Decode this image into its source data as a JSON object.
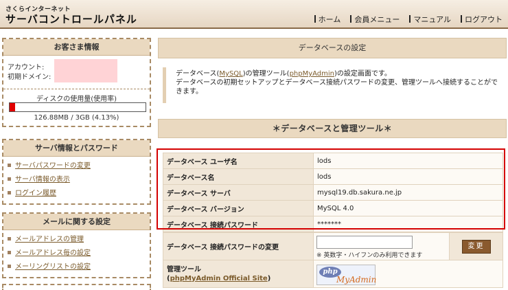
{
  "header": {
    "logo_sub": "さくらインターネット",
    "logo_main": "サーバコントロールパネル",
    "nav": [
      "ホーム",
      "会員メニュー",
      "マニュアル",
      "ログアウト"
    ]
  },
  "sidebar": {
    "customer": {
      "title": "お客さま情報",
      "account_label": "アカウント:",
      "domain_label": "初期ドメイン:",
      "disk_title": "ディスクの使用量(使用率)",
      "disk_usage": "126.88MB / 3GB (4.13%)",
      "disk_fraction": 0.0413
    },
    "server": {
      "title": "サーバ情報とパスワード",
      "items": [
        "サーバパスワードの変更",
        "サーバ情報の表示",
        "ログイン履歴"
      ]
    },
    "mail": {
      "title": "メールに関する設定",
      "items": [
        "メールアドレスの管理",
        "メールアドレス毎の設定",
        "メーリングリストの設定"
      ]
    }
  },
  "main": {
    "section_title": "データベースの設定",
    "intro_pre": "データベース(",
    "intro_link1": "MySQL",
    "intro_mid": ")の管理ツール(",
    "intro_link2": "phpMyAdmin",
    "intro_post": ")の設定画面です。",
    "intro_line2": "データベースの初期セットアップとデータベース接続パスワードの変更、管理ツールへ接続することができます。",
    "tool_section_title": "＊データベースと管理ツール＊",
    "info_rows": [
      {
        "label": "データベース ユーザ名",
        "value": "lods"
      },
      {
        "label": "データベース名",
        "value": "lods"
      },
      {
        "label": "データベース サーバ",
        "value": "mysql19.db.sakura.ne.jp"
      },
      {
        "label": "データベース バージョン",
        "value": "MySQL 4.0"
      },
      {
        "label": "データベース 接続パスワード",
        "value": "*******"
      }
    ],
    "change_pw_label": "データベース 接続パスワードの変更",
    "change_pw_note": "※ 英数字・ハイフンのみ利用できます",
    "change_button": "変更",
    "tool_label": "管理ツール",
    "tool_link_open": "(",
    "tool_link": "phpMyAdmin Official Site",
    "tool_link_close": ")",
    "logo_php": "php",
    "logo_text": "MyAdmin"
  }
}
